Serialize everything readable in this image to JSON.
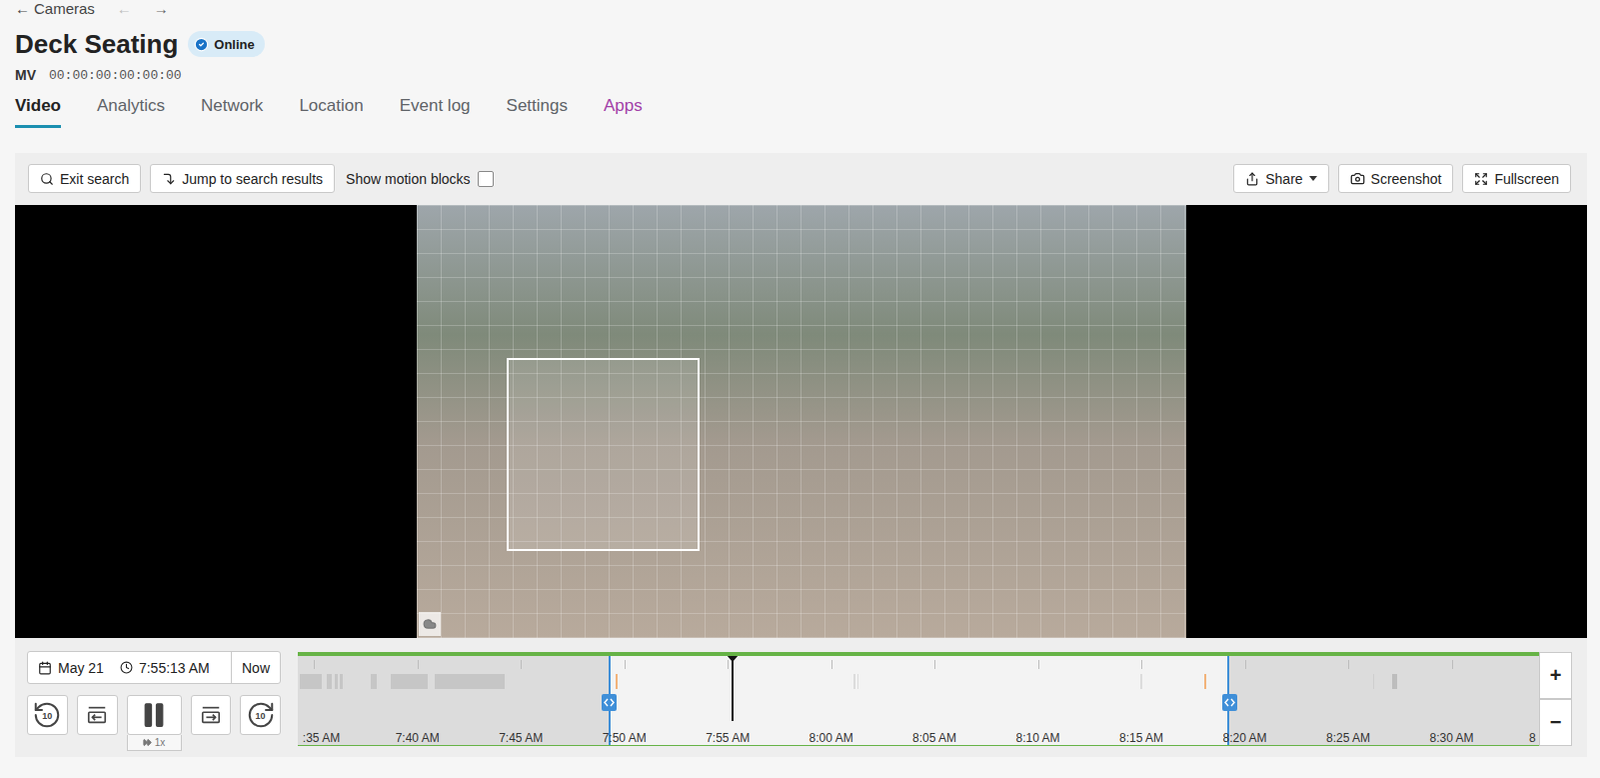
{
  "nav": {
    "back_arrow": "←",
    "back_label": "Cameras",
    "history": [
      {
        "label": "←",
        "disabled": true
      },
      {
        "label": "→",
        "disabled": false
      }
    ]
  },
  "camera": {
    "title": "Deck Seating",
    "status": {
      "label": "Online",
      "online": true
    },
    "model": "MV",
    "mac": "00:00:00:00:00:00"
  },
  "tabs": [
    {
      "label": "Video",
      "selected": true,
      "color": "#222222"
    },
    {
      "label": "Analytics",
      "selected": false,
      "color": "#5f6368"
    },
    {
      "label": "Network",
      "selected": false,
      "color": "#5f6368"
    },
    {
      "label": "Location",
      "selected": false,
      "color": "#5f6368"
    },
    {
      "label": "Event log",
      "selected": false,
      "color": "#5f6368"
    },
    {
      "label": "Settings",
      "selected": false,
      "color": "#5f6368"
    },
    {
      "label": "Apps",
      "selected": false,
      "color": "#a23fa8"
    }
  ],
  "toolbar": {
    "left_buttons": [
      "Exit search",
      "Jump to search results"
    ],
    "motion_blocks": {
      "label": "Show motion blocks",
      "checked": false
    },
    "right_buttons": [
      {
        "label": "Share",
        "dropdown": true
      },
      {
        "label": "Screenshot",
        "dropdown": false
      },
      {
        "label": "Fullscreen",
        "dropdown": false
      }
    ]
  },
  "video": {
    "search_grid": true,
    "search_region": true
  },
  "playback": {
    "date": "May 21",
    "time": "7:55:13 AM",
    "now": "Now",
    "playing": true,
    "speed": "1x",
    "skip_back": "10",
    "skip_forward": "10"
  },
  "timeline": {
    "ticks": [
      ":35 AM",
      "7:40 AM",
      "7:45 AM",
      "7:50 AM",
      "7:55 AM",
      "8:00 AM",
      "8:05 AM",
      "8:10 AM",
      "8:15 AM",
      "8:20 AM",
      "8:25 AM",
      "8:30 AM",
      "8"
    ],
    "playhead": 0.35,
    "selection": {
      "start": 0.25,
      "end": 0.75
    },
    "events": [
      {
        "start": 0.002,
        "end": 0.019,
        "color": "#c6c6c6"
      },
      {
        "start": 0.023,
        "end": 0.027,
        "color": "#c6c6c6"
      },
      {
        "start": 0.03,
        "end": 0.032,
        "color": "#c6c6c6"
      },
      {
        "start": 0.034,
        "end": 0.036,
        "color": "#c6c6c6"
      },
      {
        "start": 0.059,
        "end": 0.064,
        "color": "#c6c6c6"
      },
      {
        "start": 0.075,
        "end": 0.105,
        "color": "#c6c6c6"
      },
      {
        "start": 0.11,
        "end": 0.167,
        "color": "#c6c6c6"
      },
      {
        "start": 0.256,
        "end": 0.258,
        "color": "#f2b37a"
      },
      {
        "start": 0.448,
        "end": 0.449,
        "color": "#dcdcdc"
      },
      {
        "start": 0.451,
        "end": 0.452,
        "color": "#dcdcdc"
      },
      {
        "start": 0.679,
        "end": 0.68,
        "color": "#dcdcdc"
      },
      {
        "start": 0.73,
        "end": 0.732,
        "color": "#f2b37a"
      },
      {
        "start": 0.866,
        "end": 0.867,
        "color": "#cfcfcf"
      },
      {
        "start": 0.882,
        "end": 0.886,
        "color": "#bdbdbd"
      }
    ]
  },
  "zoom": [
    "+",
    "−"
  ]
}
